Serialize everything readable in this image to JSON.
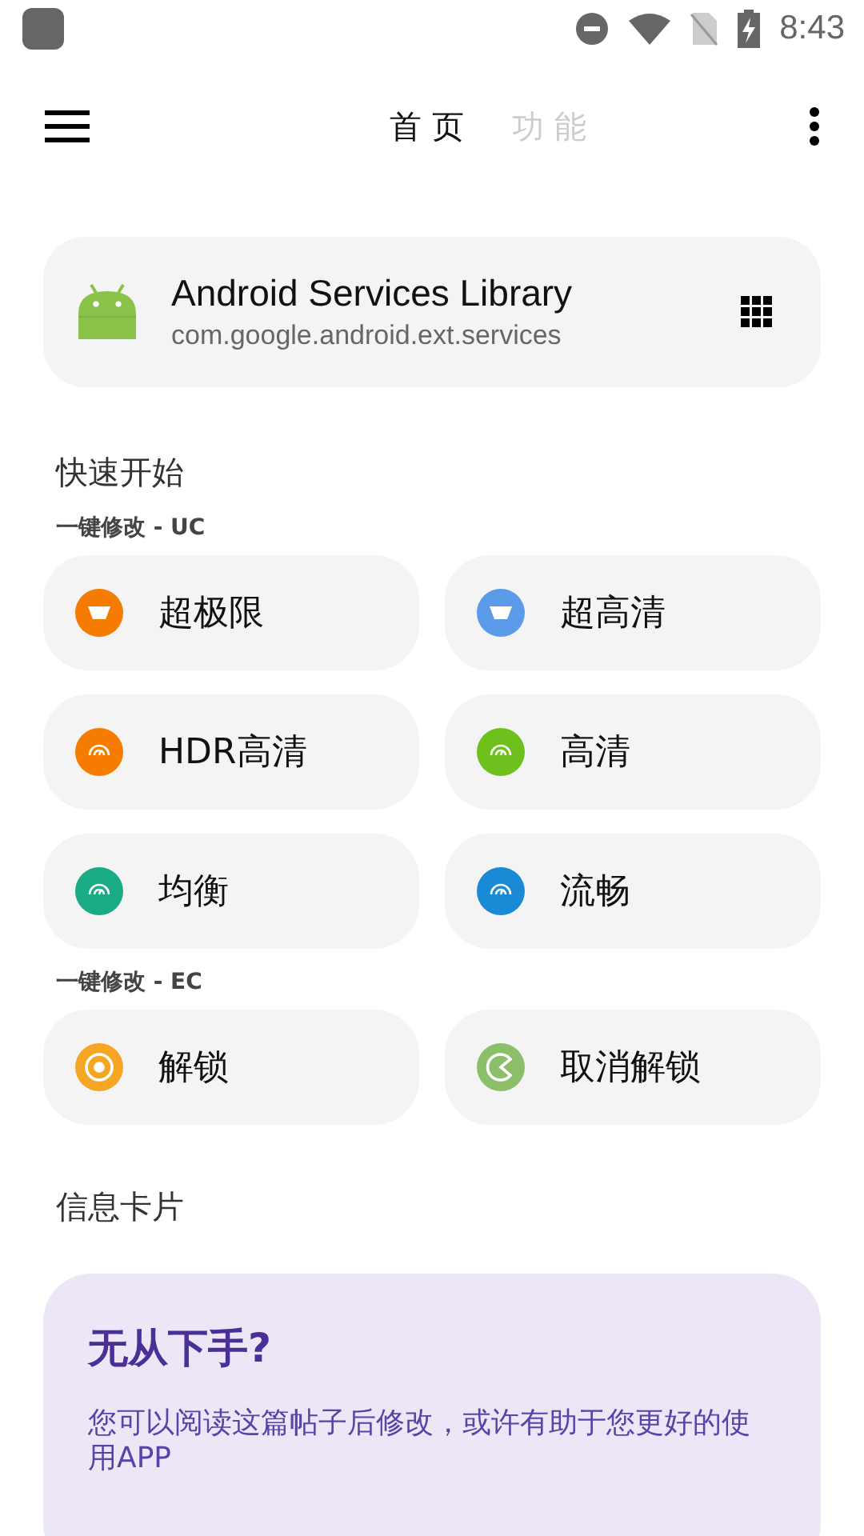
{
  "status_bar": {
    "time": "8:43"
  },
  "tabs": [
    {
      "label": "首 页",
      "selected": true
    },
    {
      "label": "功 能",
      "selected": false
    }
  ],
  "app_card": {
    "name": "Android Services Library",
    "package": "com.google.android.ext.services"
  },
  "quick_start": {
    "title": "快速开始",
    "groups": [
      {
        "label": "一键修改 - UC",
        "items": [
          {
            "label": "超极限",
            "kind": "display",
            "color": "#f57c00"
          },
          {
            "label": "超高清",
            "kind": "display",
            "color": "#5b9bea"
          },
          {
            "label": "HDR高清",
            "kind": "gauge",
            "color": "#f57c00"
          },
          {
            "label": "高清",
            "kind": "gauge",
            "color": "#6ec01c"
          },
          {
            "label": "均衡",
            "kind": "gauge",
            "color": "#1aab84"
          },
          {
            "label": "流畅",
            "kind": "gauge",
            "color": "#1a8ad6"
          }
        ]
      },
      {
        "label": "一键修改 - EC",
        "items": [
          {
            "label": "解锁",
            "kind": "lock",
            "color": "#f5a623"
          },
          {
            "label": "取消解锁",
            "kind": "unlock",
            "color": "#8cbf6a"
          }
        ]
      }
    ]
  },
  "info": {
    "title": "信息卡片",
    "card": {
      "heading": "无从下手?",
      "text": "您可以阅读这篇帖子后修改，或许有助于您更好的使用APP"
    }
  }
}
